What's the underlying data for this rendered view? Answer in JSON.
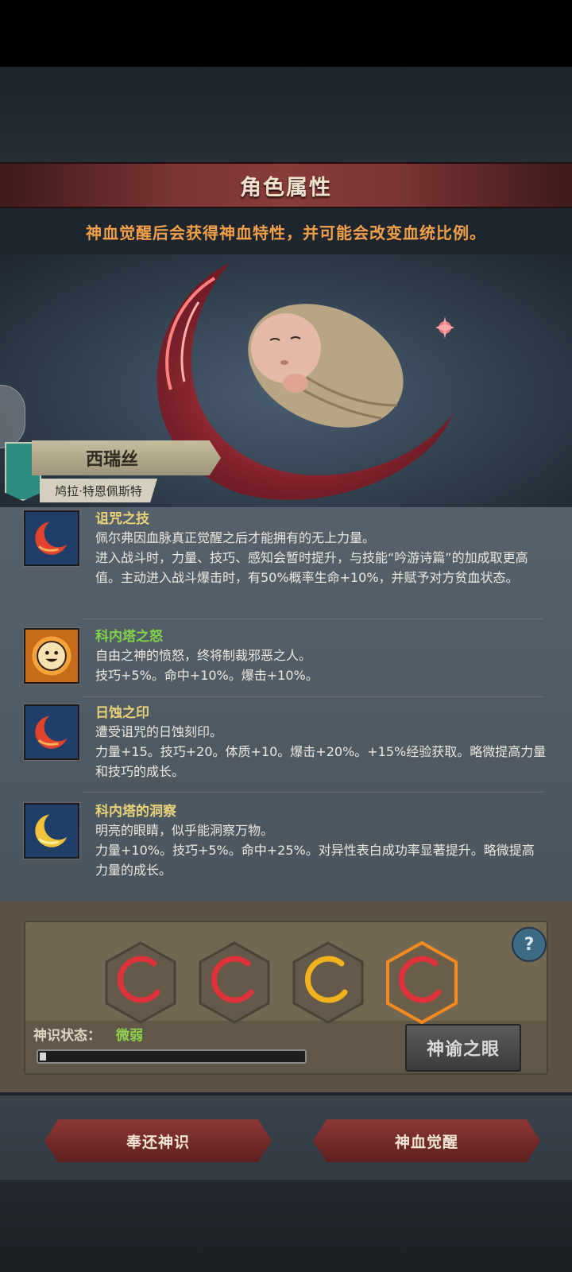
{
  "header": {
    "title": "角色属性",
    "subtitle": "神血觉醒后会获得神血特性，并可能会改变血统比例。"
  },
  "character": {
    "name": "西瑞丝",
    "house": "鸠拉·特恩佩斯特"
  },
  "traits": [
    {
      "name": "诅咒之技",
      "name_color": "#e8d27a",
      "icon": "red-crescent-icon",
      "description": "佩尔弗因血脉真正觉醒之后才能拥有的无上力量。\n进入战斗时，力量、技巧、感知会暂时提升，与技能“吟游诗篇”的加成取更高值。主动进入战斗爆击时，有50%概率生命+10%，并赋予对方贫血状态。"
    },
    {
      "name": "科内塔之怒",
      "name_color": "#7fd24a",
      "icon": "smiling-sun-icon",
      "description": "自由之神的愤怒，终将制裁邪恶之人。\n技巧+5%。命中+10%。爆击+10%。"
    },
    {
      "name": "日蚀之印",
      "name_color": "#e8d27a",
      "icon": "red-crescent-icon",
      "description": "遭受诅咒的日蚀刻印。\n力量+15。技巧+20。体质+10。爆击+20%。+15%经验获取。略微提高力量和技巧的成长。"
    },
    {
      "name": "科内塔的洞察",
      "name_color": "#e8d27a",
      "icon": "yellow-crescent-icon",
      "description": "明亮的眼睛，似乎能洞察万物。\n力量+10%。技巧+5%。命中+25%。对异性表白成功率显著提升。略微提高力量的成长。"
    }
  ],
  "slots": [
    {
      "icon": "red-crescent-icon",
      "color": "#e0323a",
      "selected": false
    },
    {
      "icon": "red-crescent-icon",
      "color": "#e0323a",
      "selected": false
    },
    {
      "icon": "yellow-crescent-icon",
      "color": "#f2b21e",
      "selected": false
    },
    {
      "icon": "red-crescent-icon",
      "color": "#e0323a",
      "selected": true
    }
  ],
  "status": {
    "label": "神识状态：",
    "value": "微弱",
    "progress": 0.02
  },
  "buttons": {
    "oracle_eye": "神谕之眼",
    "return_divinity": "奉还神识",
    "blood_awakening": "神血觉醒"
  },
  "colors": {
    "accent_orange": "#f3a04a",
    "status_green": "#8ed34e",
    "banner_red": "#7a3434"
  }
}
